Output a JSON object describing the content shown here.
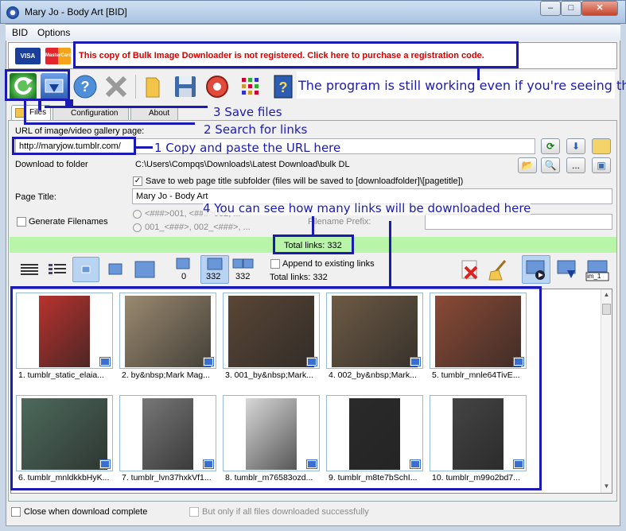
{
  "window": {
    "title": "Mary Jo - Body Art [BID]",
    "min": "–",
    "max": "□",
    "close": "✕"
  },
  "menu": {
    "items": [
      "BID",
      "Options"
    ]
  },
  "banner": {
    "visa": "VISA",
    "mastercard": "MasterCard",
    "registration_text": "This copy of Bulk Image Downloader is not registered. Click here to purchase a registration code."
  },
  "toolbar": {
    "icons": [
      "refresh-icon",
      "download-icon",
      "help-icon",
      "cancel-icon",
      "folder-icon",
      "save-icon",
      "settings-icon",
      "grid-icon",
      "info-book-icon"
    ]
  },
  "tabs": [
    "Files",
    "Configuration",
    "About"
  ],
  "form": {
    "url_label": "URL of image/video gallery page:",
    "url_value": "http://maryjow.tumblr.com/",
    "folder_label": "Download to folder",
    "folder_value": "C:\\Users\\Compqs\\Downloads\\Latest Download\\bulk DL",
    "subfolder_label": "Save to web page title subfolder (files will be saved to [downloadfolder]\\[pagetitle])",
    "page_title_label": "Page Title:",
    "page_title_value": "Mary Jo - Body Art",
    "generate_filenames": "Generate Filenames",
    "radio1": "<###>001, <###>002, ...",
    "radio2": "001_<###>, 002_<###>, ...",
    "prefix_label": "Filename Prefix:",
    "ellipsis": "..."
  },
  "status": {
    "total_links_bar": "Total links: 332"
  },
  "viewbar": {
    "count_a": "0",
    "count_b": "332",
    "count_c": "332",
    "append_label": "Append to existing links",
    "total_links": "Total links: 332",
    "im_label": "im_1"
  },
  "thumbnails": [
    {
      "caption": "1. tumblr_static_elaia...",
      "color": "#b8322e"
    },
    {
      "caption": "2. by&nbsp;Mark Mag...",
      "color": "#9a8a70"
    },
    {
      "caption": "3. 001_by&nbsp;Mark...",
      "color": "#5a4636"
    },
    {
      "caption": "4. 002_by&nbsp;Mark...",
      "color": "#6d5a44"
    },
    {
      "caption": "5. tumblr_mnle64TivE...",
      "color": "#8a4a36"
    },
    {
      "caption": "6. tumblr_mnldkkbHyK...",
      "color": "#4d6a5c"
    },
    {
      "caption": "7. tumblr_lvn37hxkVf1...",
      "color": "#777777"
    },
    {
      "caption": "8. tumblr_m76583ozd...",
      "color": "#d8d8d8"
    },
    {
      "caption": "9. tumblr_m8te7bSchI...",
      "color": "#2a2a2a"
    },
    {
      "caption": "10. tumblr_m99o2bd7...",
      "color": "#444444"
    }
  ],
  "footer": {
    "close_label": "Close when download complete",
    "only_label": "But only if all files downloaded successfully"
  },
  "annotations": {
    "still_working": "The program is still working even if you're seeing this",
    "save_files": "3  Save files",
    "search_links": "2  Search for links",
    "copy_paste": "1 Copy and paste the URL here",
    "links_count": "4  You can see how many links will be downloaded here"
  },
  "colors": {
    "annotation": "#1b1bb3",
    "registration": "#d30000",
    "total_bar": "#b8f5a9"
  }
}
